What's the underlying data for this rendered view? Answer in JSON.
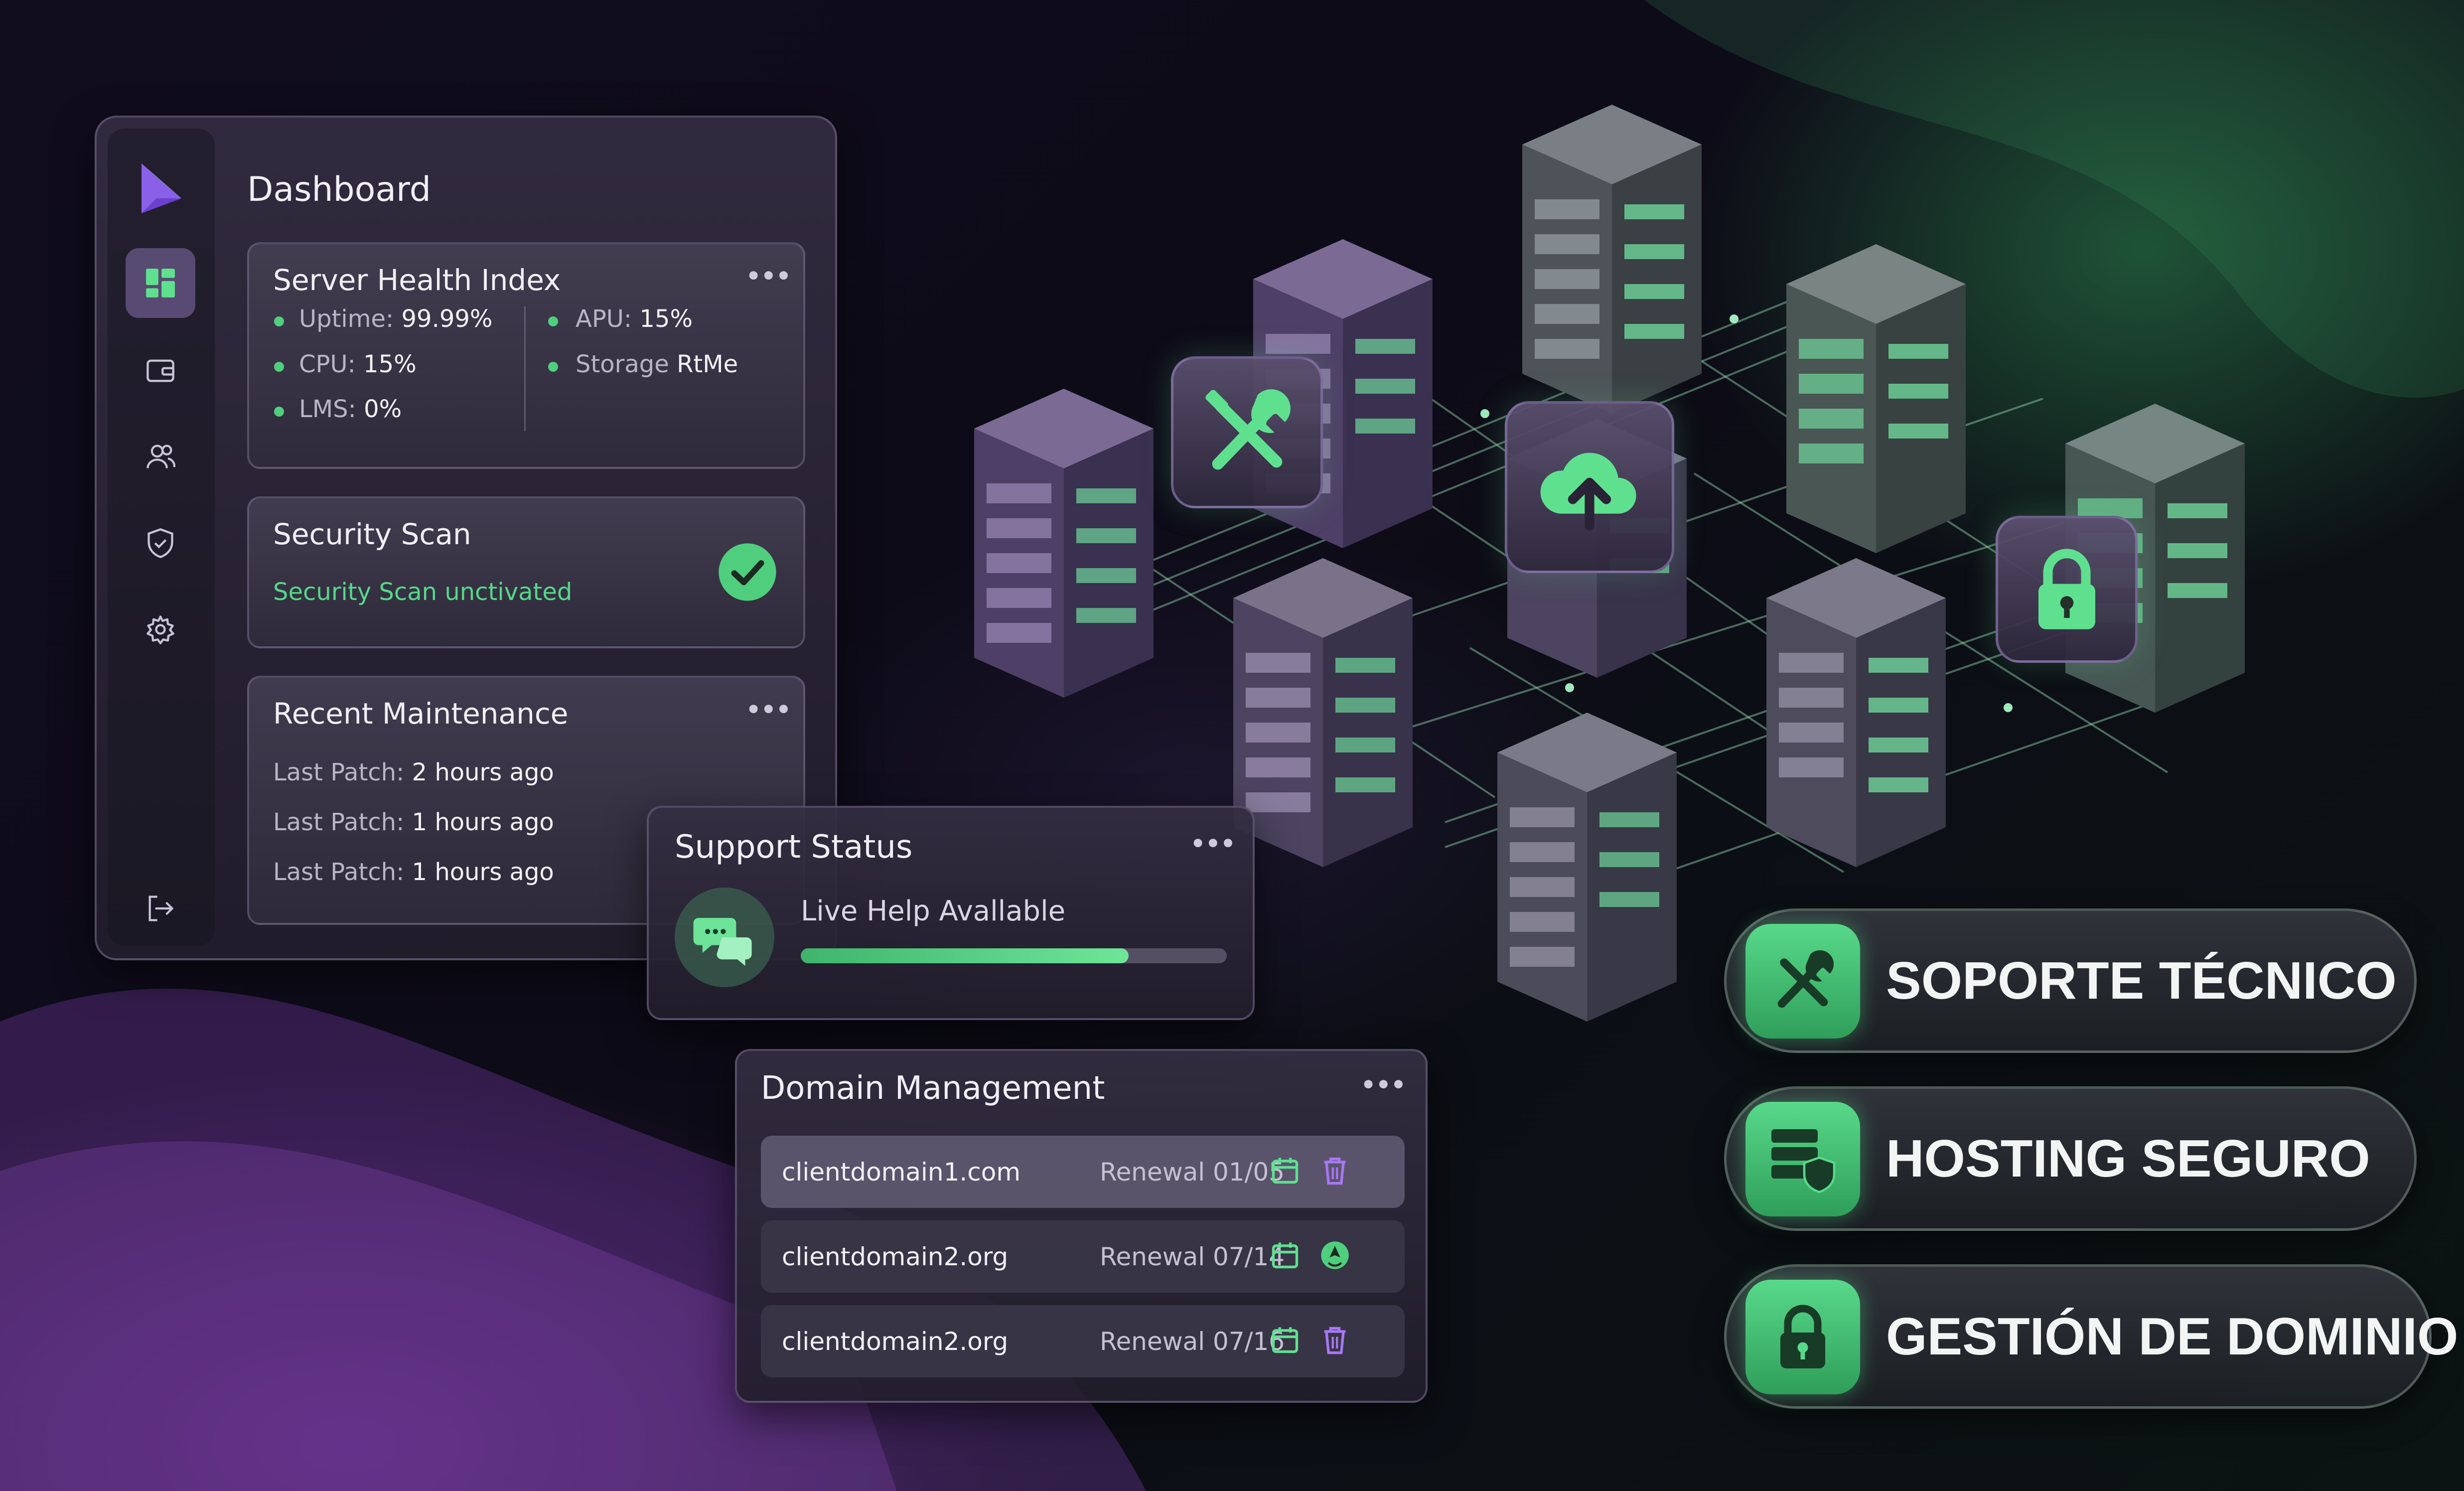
{
  "dashboard": {
    "title": "Dashboard",
    "nav": [
      "dashboard-icon",
      "wallet-icon",
      "users-icon",
      "shield-icon",
      "settings-icon",
      "logout-icon"
    ],
    "server_health": {
      "title": "Server Health Index",
      "left": [
        {
          "label": "Uptime:",
          "value": "99.99%"
        },
        {
          "label": "CPU:",
          "value": "15%"
        },
        {
          "label": "LMS:",
          "value": "0%"
        }
      ],
      "right": [
        {
          "label": "APU:",
          "value": "15%"
        },
        {
          "label": "Storage",
          "value": "RtMe"
        }
      ]
    },
    "security_scan": {
      "title": "Security Scan",
      "status": "Security Scan unctivated"
    },
    "maintenance": {
      "title": "Recent Maintenance",
      "items": [
        {
          "label": "Last Patch:",
          "value": "2 hours ago"
        },
        {
          "label": "Last Patch:",
          "value": "1 hours ago"
        },
        {
          "label": "Last Patch:",
          "value": "1 hours ago"
        }
      ]
    }
  },
  "support": {
    "title": "Support Status",
    "status": "Live Help Avallable",
    "progress": 0.77
  },
  "domains": {
    "title": "Domain Management",
    "rows": [
      {
        "domain": "clientdomain1.com",
        "renewal": "Renewal 01/05",
        "icons": [
          "calendar-icon",
          "trash-icon"
        ]
      },
      {
        "domain": "clientdomain2.org",
        "renewal": "Renewal 07/14",
        "icons": [
          "calendar-icon",
          "refresh-icon"
        ]
      },
      {
        "domain": "clientdomain2.org",
        "renewal": "Renewal 07/16",
        "icons": [
          "calendar-icon",
          "trash-icon"
        ]
      }
    ]
  },
  "badges": [
    {
      "label": "SOPORTE TÉCNICO",
      "icon": "tools-icon"
    },
    {
      "label": "HOSTING SEGURO",
      "icon": "secure-server-icon"
    },
    {
      "label": "GESTIÓN DE DOMINIO",
      "icon": "lock-icon"
    }
  ],
  "colors": {
    "accent_green": "#4fcf7e",
    "accent_purple": "#9a6cf0",
    "background": "#0e0c18"
  }
}
